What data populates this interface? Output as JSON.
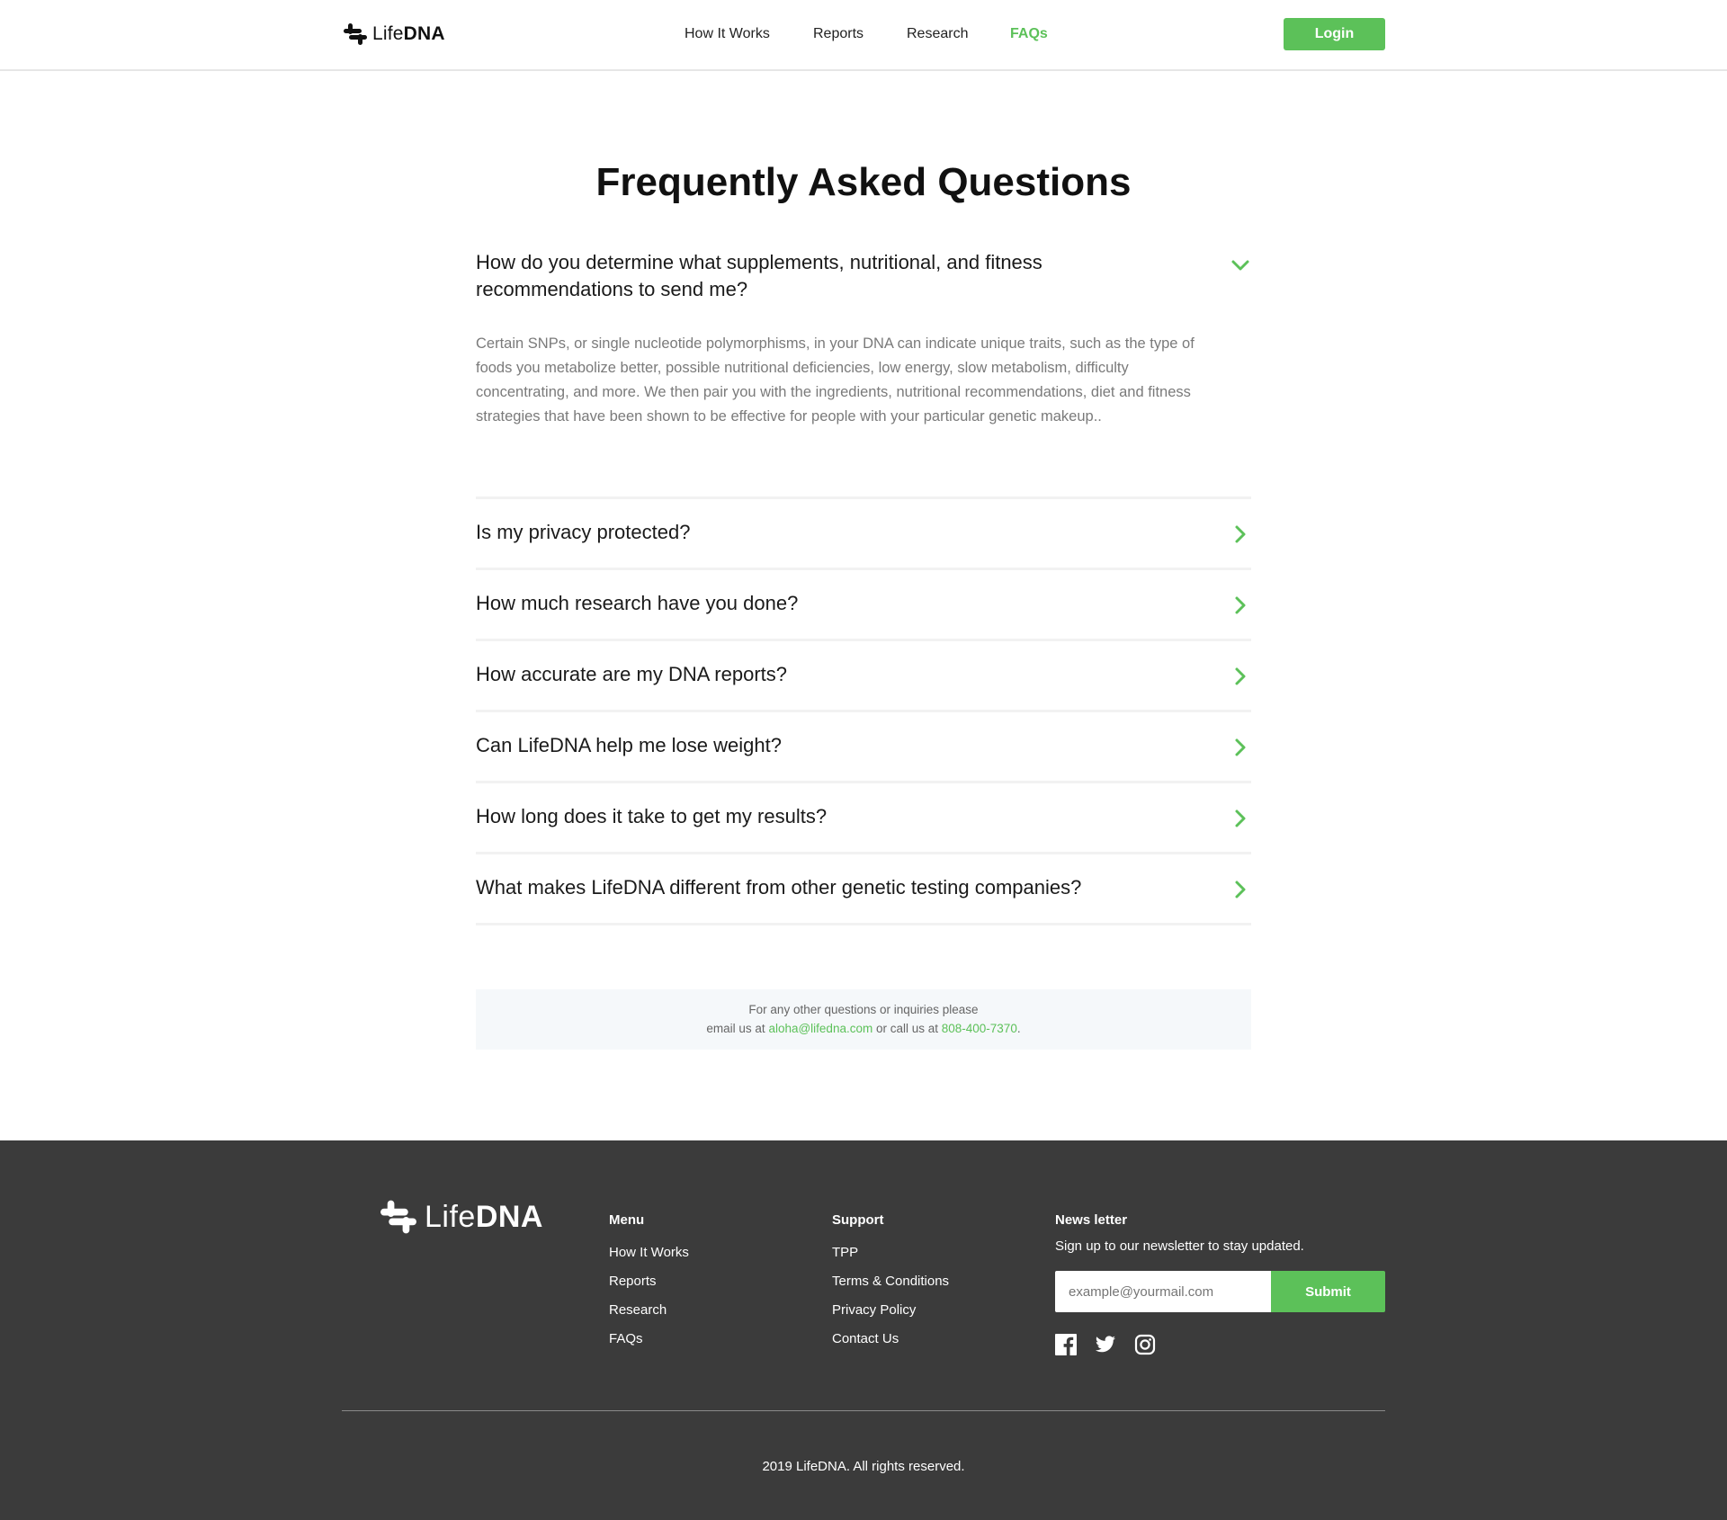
{
  "header": {
    "logo": {
      "light": "Life",
      "bold": "DNA"
    },
    "nav": [
      {
        "label": "How It Works"
      },
      {
        "label": "Reports"
      },
      {
        "label": "Research"
      },
      {
        "label": "FAQs",
        "active": true
      }
    ],
    "login_label": "Login"
  },
  "main": {
    "title": "Frequently Asked Questions",
    "open_faq": {
      "question": "How do you determine what supplements, nutritional, and fitness recommendations to send me?",
      "answer": "Certain SNPs, or single nucleotide polymorphisms, in your DNA can indicate unique traits, such as the type of foods you metabolize better, possible nutritional deficiencies, low energy, slow metabolism, difficulty concentrating, and more. We then pair you with the ingredients, nutritional recommendations, diet and fitness strategies that have been shown to be effective for people with your particular genetic makeup.."
    },
    "faqs": [
      "Is my privacy protected?",
      "How much research have you done?",
      "How accurate are my DNA reports?",
      "Can LifeDNA help me lose weight?",
      "How long does it take to get my results?",
      "What makes LifeDNA different from other genetic testing companies?"
    ],
    "contact": {
      "line1": "For any other questions or inquiries please",
      "prefix": "email us at ",
      "email": "aloha@lifedna.com",
      "middle": " or call us at ",
      "phone": "808-400-7370",
      "suffix": "."
    }
  },
  "footer": {
    "logo": {
      "light": "Life",
      "bold": "DNA"
    },
    "menu": {
      "title": "Menu",
      "items": [
        "How It Works",
        "Reports",
        "Research",
        "FAQs"
      ]
    },
    "support": {
      "title": "Support",
      "items": [
        "TPP",
        "Terms & Conditions",
        "Privacy Policy",
        "Contact Us"
      ]
    },
    "newsletter": {
      "title": "News letter",
      "text": "Sign up to our newsletter to stay updated.",
      "placeholder": "example@yourmail.com",
      "submit_label": "Submit"
    },
    "socials": [
      "facebook-icon",
      "twitter-icon",
      "instagram-icon"
    ],
    "copyright": "2019 LifeDNA. All rights reserved."
  },
  "colors": {
    "accent": "#5cc159",
    "footer_bg": "#3b3b3b",
    "text": "#1a1a1a",
    "muted": "#7a7a7a"
  }
}
